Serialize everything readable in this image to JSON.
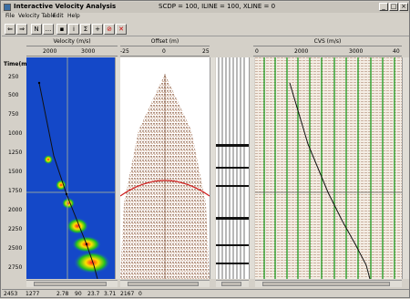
{
  "window": {
    "title": "Interactive Velocity Analysis",
    "status_title": "SCDP = 100, ILINE = 100, XLINE = 0"
  },
  "menu": [
    "File",
    "Velocity Table",
    "Edit",
    "Help"
  ],
  "panels": {
    "velocity": {
      "header": "Velocity (m/s)",
      "ticks": [
        "2000",
        "3000"
      ]
    },
    "offset": {
      "header": "Offset (m)",
      "ticks": [
        "-25",
        "0",
        "25"
      ]
    },
    "cvs": {
      "header": "CVS (m/s)",
      "ticks": [
        "0",
        "2000",
        "3000",
        "40"
      ]
    }
  },
  "time_axis": {
    "label": "Time(ms)",
    "ticks": [
      "250",
      "500",
      "750",
      "1000",
      "1250",
      "1500",
      "1750",
      "2000",
      "2250",
      "2500",
      "2750"
    ]
  },
  "toolbar": {
    "icons": [
      "back-icon",
      "forward-icon",
      "n-icon",
      "dots-icon",
      "save-icon",
      "info-icon",
      "sigma-icon",
      "plus-icon",
      "stop-icon",
      "close-icon"
    ],
    "labels": [
      "N",
      "...",
      "Σ",
      "+"
    ]
  },
  "status": {
    "items": [
      "2453",
      "1277",
      "2.78",
      "90",
      "23.7",
      "3.71",
      "2167",
      "0"
    ]
  }
}
